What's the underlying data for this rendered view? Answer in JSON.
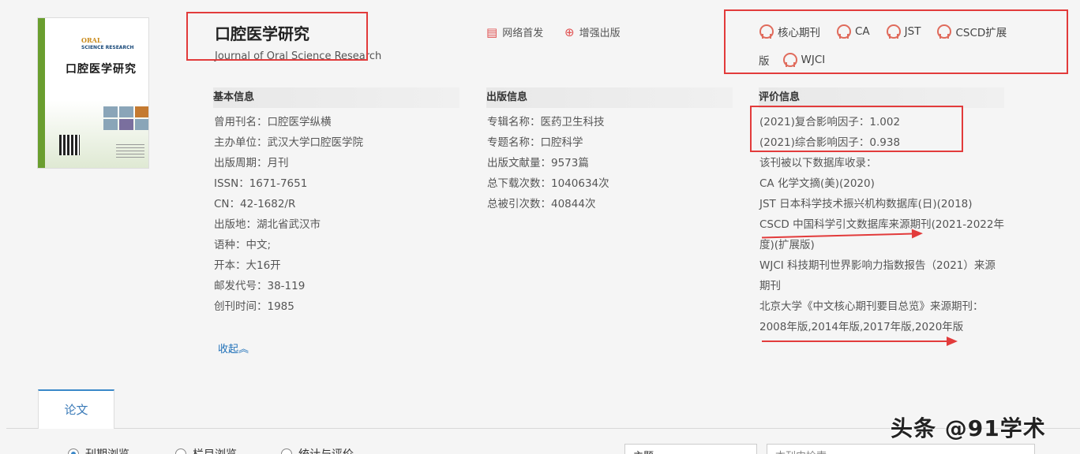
{
  "journal": {
    "title_zh": "口腔医学研究",
    "title_en": "Journal of Oral Science Research",
    "cover_text_en": "ORAL",
    "cover_text_en2": "SCIENCE RESEARCH",
    "cover_text_zh": "口腔医学研究"
  },
  "tags": [
    {
      "label": "网络首发",
      "icon": "doc-icon"
    },
    {
      "label": "增强出版",
      "icon": "globe-icon"
    }
  ],
  "badges": {
    "row1": [
      "核心期刊",
      "CA",
      "JST",
      "CSCD扩展"
    ],
    "row2_prefix": "版",
    "row2": [
      "WJCI"
    ]
  },
  "basic_info": {
    "heading": "基本信息",
    "items": [
      {
        "k": "曾用刊名：",
        "v": "口腔医学纵横"
      },
      {
        "k": "主办单位：",
        "v": "武汉大学口腔医学院"
      },
      {
        "k": "出版周期：",
        "v": "月刊"
      },
      {
        "k": "ISSN：",
        "v": "1671-7651"
      },
      {
        "k": "CN：",
        "v": "42-1682/R"
      },
      {
        "k": "出版地：",
        "v": "湖北省武汉市"
      },
      {
        "k": "语种：",
        "v": "中文;"
      },
      {
        "k": "开本：",
        "v": "大16开"
      },
      {
        "k": "邮发代号：",
        "v": "38-119"
      },
      {
        "k": "创刊时间：",
        "v": "1985"
      }
    ]
  },
  "publish_info": {
    "heading": "出版信息",
    "items": [
      {
        "k": "专辑名称：",
        "v": "医药卫生科技"
      },
      {
        "k": "专题名称：",
        "v": "口腔科学"
      },
      {
        "k": "出版文献量：",
        "v": "9573篇"
      },
      {
        "k": "总下载次数：",
        "v": "1040634次"
      },
      {
        "k": "总被引次数：",
        "v": "40844次"
      }
    ]
  },
  "eval_info": {
    "heading": "评价信息",
    "lines": [
      "(2021)复合影响因子：1.002",
      "(2021)综合影响因子：0.938",
      "该刊被以下数据库收录：",
      "CA 化学文摘(美)(2020)",
      "JST 日本科学技术振兴机构数据库(日)(2018)",
      "CSCD 中国科学引文数据库来源期刊(2021-2022年",
      "度)(扩展版)",
      "WJCI 科技期刊世界影响力指数报告（2021）来源",
      "期刊",
      "北京大学《中文核心期刊要目总览》来源期刊：",
      "2008年版,2014年版,2017年版,2020年版"
    ]
  },
  "collapse_label": "收起︽",
  "tab_active": "论文",
  "radios": [
    "刊期浏览",
    "栏目浏览",
    "统计与评价"
  ],
  "select_value": "主题",
  "search_placeholder": "本刊内检索",
  "watermark": "头条 @91学术",
  "colors": {
    "annotation_red": "#e23b3b",
    "link_blue": "#1d6fb8"
  }
}
